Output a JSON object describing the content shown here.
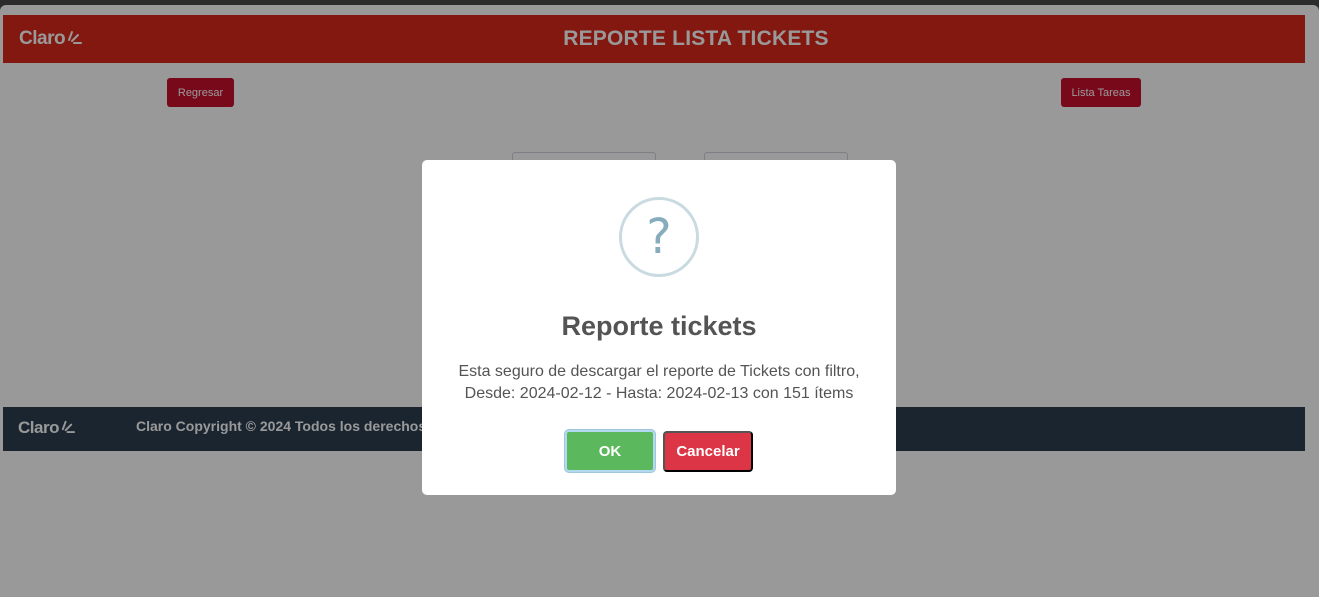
{
  "header": {
    "logo_text": "Claro",
    "title": "REPORTE LISTA TICKETS",
    "brand_color": "#da291c"
  },
  "toolbar": {
    "back_label": "Regresar",
    "tasks_label": "Lista Tareas"
  },
  "footer": {
    "logo_text": "Claro",
    "copyright": "Claro Copyright © 2024 Todos los derechos reservados"
  },
  "dialog": {
    "icon": "question-icon",
    "icon_glyph": "?",
    "title": "Reporte tickets",
    "message_line1": "Esta seguro de descargar el reporte de Tickets con filtro,",
    "message_line2": "Desde: 2024-02-12 - Hasta: 2024-02-13 con 151 ítems",
    "ok_label": "OK",
    "cancel_label": "Cancelar",
    "ok_color": "#5cb85c",
    "cancel_color": "#dc3545"
  }
}
